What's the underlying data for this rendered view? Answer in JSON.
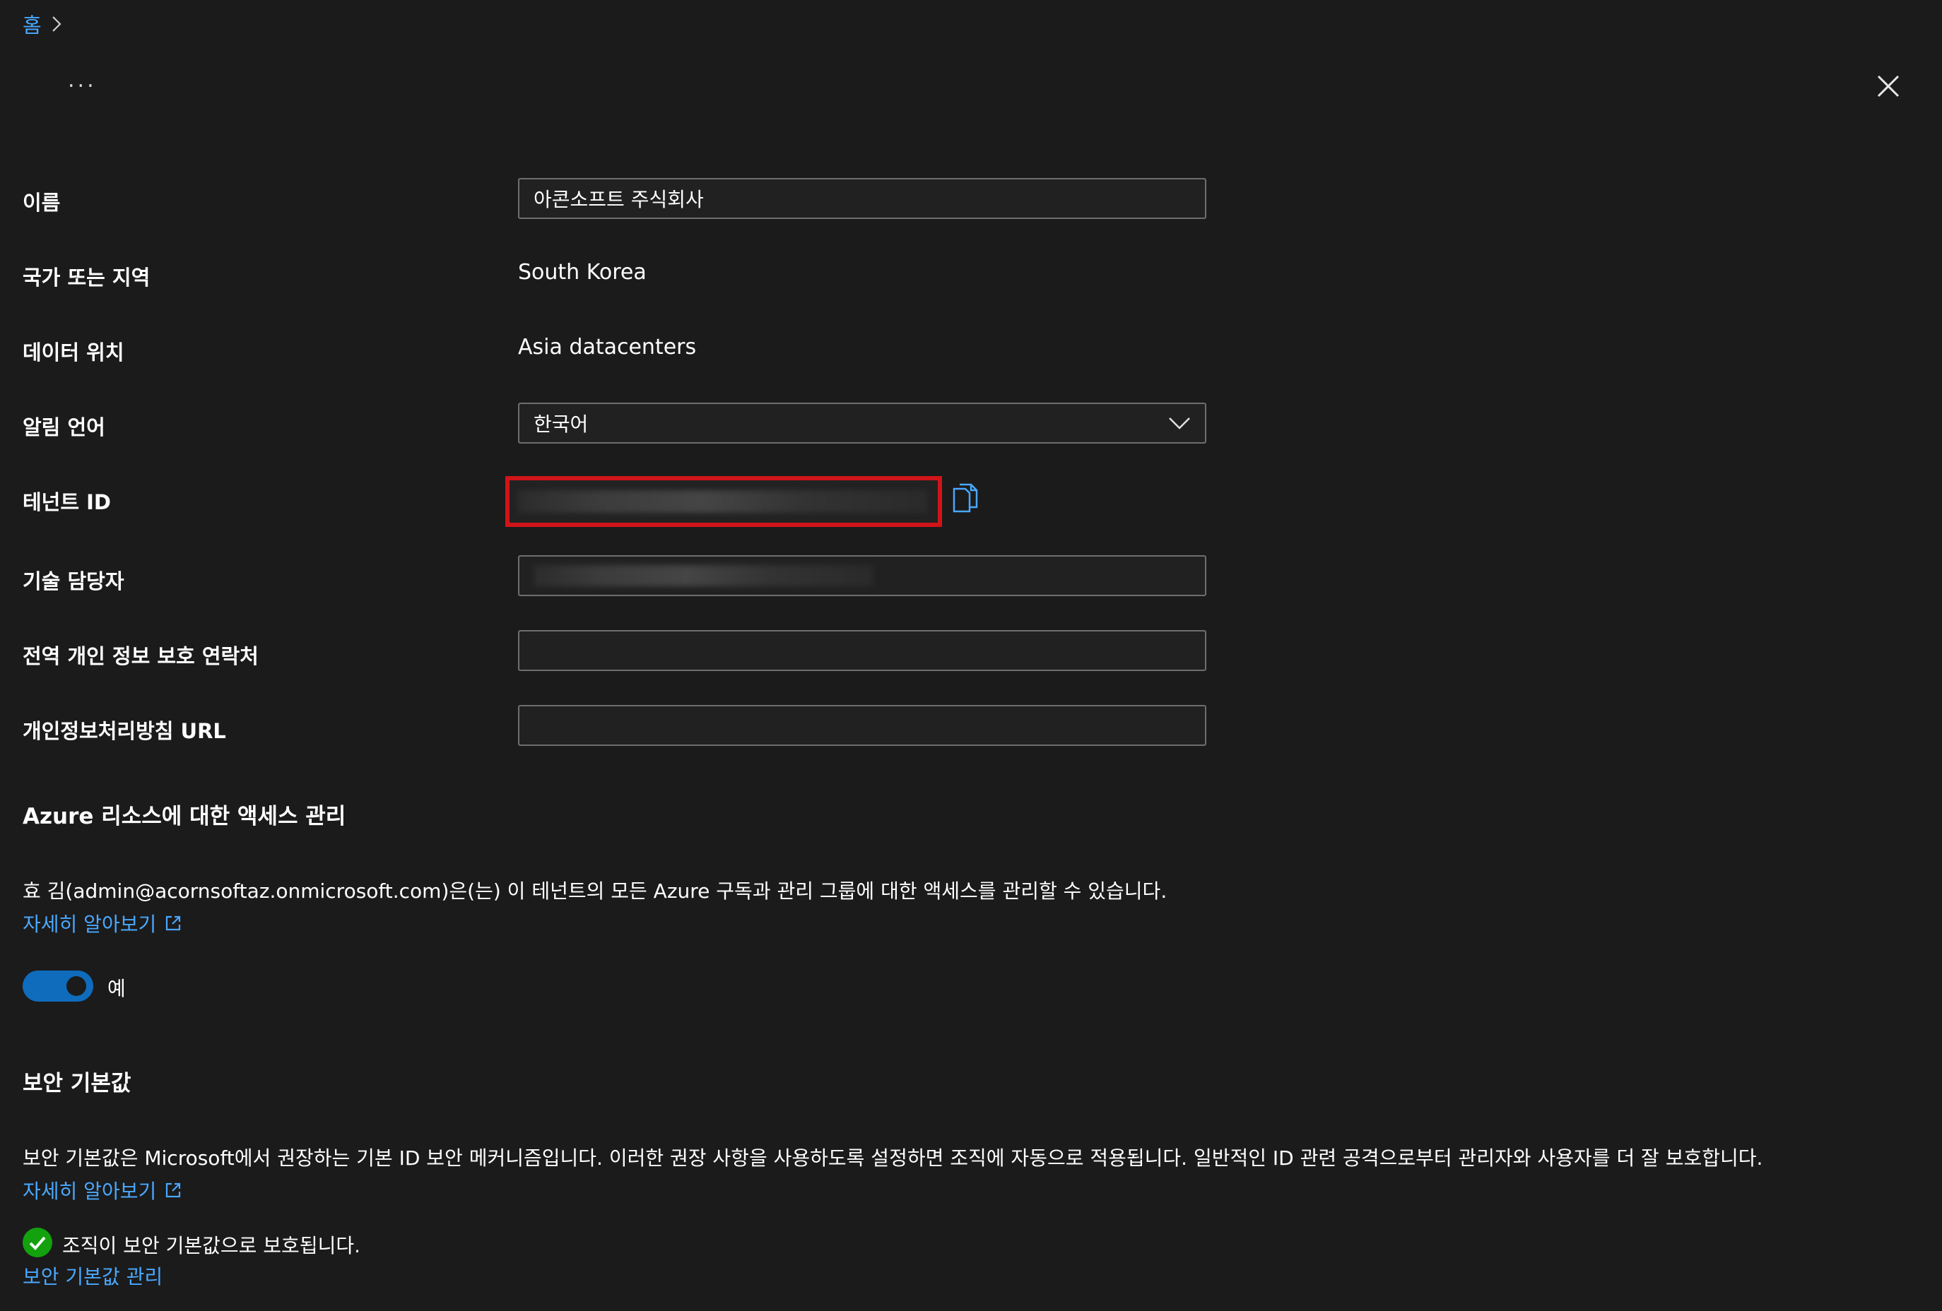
{
  "breadcrumb": {
    "home": "홈"
  },
  "header": {
    "more": "..."
  },
  "fields": {
    "name": {
      "label": "이름",
      "value": "아콘소프트 주식회사"
    },
    "country": {
      "label": "국가 또는 지역",
      "value": "South Korea"
    },
    "data_location": {
      "label": "데이터 위치",
      "value": "Asia datacenters"
    },
    "notification_language": {
      "label": "알림 언어",
      "value": "한국어"
    },
    "tenant_id": {
      "label": "테넌트 ID"
    },
    "technical_contact": {
      "label": "기술 담당자"
    },
    "privacy_contact": {
      "label": "전역 개인 정보 보호 연락처",
      "value": ""
    },
    "privacy_url": {
      "label": "개인정보처리방침 URL",
      "value": ""
    }
  },
  "access": {
    "title": "Azure 리소스에 대한 액세스 관리",
    "description": "효 김(admin@acornsoftaz.onmicrosoft.com)은(는) 이 테넌트의 모든 Azure 구독과 관리 그룹에 대한 액세스를 관리할 수 있습니다.",
    "learn_more": "자세히 알아보기",
    "toggle_label": "예",
    "toggle_on": true
  },
  "security": {
    "title": "보안 기본값",
    "description": "보안 기본값은 Microsoft에서 권장하는 기본 ID 보안 메커니즘입니다. 이러한 권장 사항을 사용하도록 설정하면 조직에 자동으로 적용됩니다. 일반적인 ID 관련 공격으로부터 관리자와 사용자를 더 잘 보호합니다.",
    "learn_more": "자세히 알아보기",
    "status": "조직이 보안 기본값으로 보호됩니다.",
    "manage_link": "보안 기본값 관리"
  },
  "colors": {
    "accent": "#4aa8ff",
    "toggle": "#0f6cbd",
    "success": "#13a10e",
    "highlight": "#d11419"
  }
}
